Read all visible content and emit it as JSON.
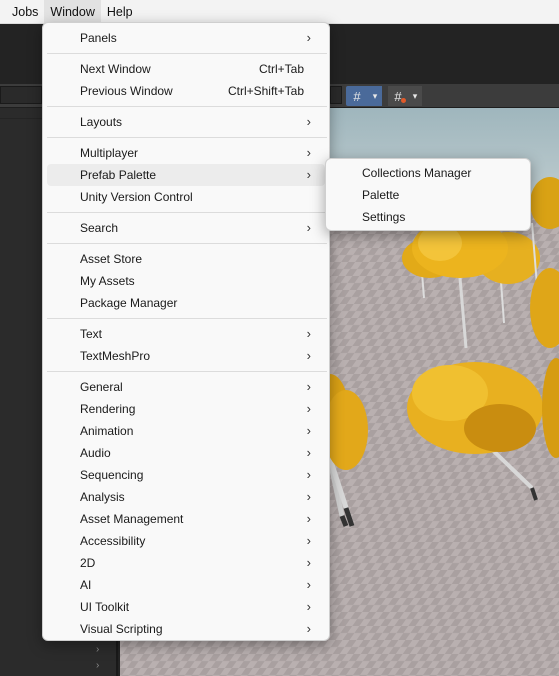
{
  "menubar": {
    "items": [
      {
        "label": "Jobs"
      },
      {
        "label": "Window"
      },
      {
        "label": "Help"
      }
    ]
  },
  "window_menu": {
    "groups": [
      [
        {
          "label": "Panels",
          "submenu": true
        }
      ],
      [
        {
          "label": "Next Window",
          "shortcut": "Ctrl+Tab"
        },
        {
          "label": "Previous Window",
          "shortcut": "Ctrl+Shift+Tab"
        }
      ],
      [
        {
          "label": "Layouts",
          "submenu": true
        }
      ],
      [
        {
          "label": "Multiplayer",
          "submenu": true
        },
        {
          "label": "Prefab Palette",
          "submenu": true,
          "highlighted": true
        },
        {
          "label": "Unity Version Control"
        }
      ],
      [
        {
          "label": "Search",
          "submenu": true
        }
      ],
      [
        {
          "label": "Asset Store"
        },
        {
          "label": "My Assets"
        },
        {
          "label": "Package Manager"
        }
      ],
      [
        {
          "label": "Text",
          "submenu": true
        },
        {
          "label": "TextMeshPro",
          "submenu": true
        }
      ],
      [
        {
          "label": "General",
          "submenu": true
        },
        {
          "label": "Rendering",
          "submenu": true
        },
        {
          "label": "Animation",
          "submenu": true
        },
        {
          "label": "Audio",
          "submenu": true
        },
        {
          "label": "Sequencing",
          "submenu": true
        },
        {
          "label": "Analysis",
          "submenu": true
        },
        {
          "label": "Asset Management",
          "submenu": true
        },
        {
          "label": "Accessibility",
          "submenu": true
        },
        {
          "label": "2D",
          "submenu": true
        },
        {
          "label": "AI",
          "submenu": true
        },
        {
          "label": "UI Toolkit",
          "submenu": true
        },
        {
          "label": "Visual Scripting",
          "submenu": true
        }
      ]
    ],
    "arrow_glyph": "›"
  },
  "prefab_palette_submenu": {
    "items": [
      {
        "label": "Collections Manager"
      },
      {
        "label": "Palette"
      },
      {
        "label": "Settings"
      }
    ]
  },
  "scene_toolbar": {
    "grid_icon": "grid-icon",
    "snap_icon": "grid-snap-icon",
    "dropdown_glyph": "▾"
  },
  "colors": {
    "menu_bg": "#f9f9f9",
    "highlight": "#ececec",
    "toolbar_active": "#4a6a9a",
    "foliage": "#e8b020",
    "ground": "#b7aeae"
  }
}
